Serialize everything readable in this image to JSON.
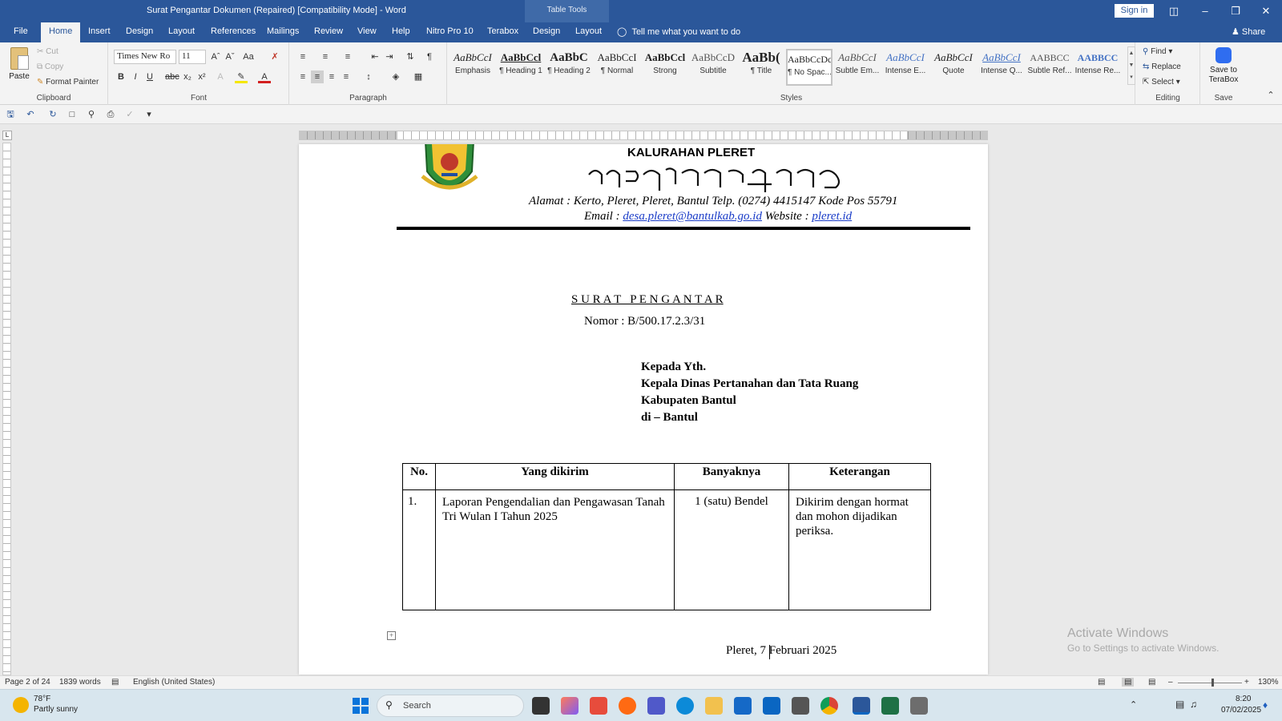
{
  "window": {
    "title": "Surat Pengantar Dokumen (Repaired) [Compatibility Mode]  -  Word",
    "contextual_tab_group": "Table Tools",
    "sign_in": "Sign in"
  },
  "tabs": {
    "file": "File",
    "home": "Home",
    "insert": "Insert",
    "design": "Design",
    "layout": "Layout",
    "references": "References",
    "mailings": "Mailings",
    "review": "Review",
    "view": "View",
    "help": "Help",
    "nitro": "Nitro Pro 10",
    "terabox": "Terabox",
    "table_design": "Design",
    "table_layout": "Layout",
    "tell_me": "Tell me what you want to do",
    "share": "Share"
  },
  "ribbon": {
    "clipboard": {
      "paste": "Paste",
      "cut": "Cut",
      "copy": "Copy",
      "format_painter": "Format Painter",
      "label": "Clipboard"
    },
    "font": {
      "name": "Times New Ro",
      "size": "11",
      "label": "Font"
    },
    "paragraph": {
      "label": "Paragraph"
    },
    "styles": {
      "label": "Styles",
      "items": [
        {
          "preview": "AaBbCcI",
          "name": "Emphasis"
        },
        {
          "preview": "AaBbCcl",
          "name": "¶ Heading 1"
        },
        {
          "preview": "AaBbC",
          "name": "¶ Heading 2"
        },
        {
          "preview": "AaBbCcI",
          "name": "¶ Normal"
        },
        {
          "preview": "AaBbCcl",
          "name": "Strong"
        },
        {
          "preview": "AaBbCcD",
          "name": "Subtitle"
        },
        {
          "preview": "AaBb(",
          "name": "¶ Title"
        },
        {
          "preview": "AaBbCcDc",
          "name": "¶ No Spac..."
        },
        {
          "preview": "AaBbCcI",
          "name": "Subtle Em..."
        },
        {
          "preview": "AaBbCcI",
          "name": "Intense E..."
        },
        {
          "preview": "AaBbCcI",
          "name": "Quote"
        },
        {
          "preview": "AaBbCcI",
          "name": "Intense Q..."
        },
        {
          "preview": "AABBCC",
          "name": "Subtle Ref..."
        },
        {
          "preview": "AABBCC",
          "name": "Intense Re..."
        }
      ]
    },
    "editing": {
      "find": "Find",
      "replace": "Replace",
      "select": "Select",
      "label": "Editing"
    },
    "save": {
      "button": "Save to TeraBox",
      "label": "Save"
    }
  },
  "document": {
    "org": "KALURAHAN PLERET",
    "address_line": "Alamat : Kerto, Pleret, Pleret, Bantul Telp. (0274) 4415147  Kode Pos 55791",
    "email_label": "Email : ",
    "email": "desa.pleret@bantulkab.go.id",
    "website_label": " Website : ",
    "website": "pleret.id",
    "heading": "S U R A T   P E N G A N T A R",
    "number": "Nomor : B/500.17.2.3/31",
    "recipient": [
      "Kepada Yth.",
      "Kepala Dinas Pertanahan dan Tata Ruang",
      "Kabupaten Bantul",
      "di – Bantul"
    ],
    "table": {
      "headers": [
        "No.",
        "Yang dikirim",
        "Banyaknya",
        "Keterangan"
      ],
      "rows": [
        [
          "1.",
          "Laporan Pengendalian dan Pengawasan Tanah Tri Wulan I Tahun 2025",
          "1 (satu) Bendel",
          "Dikirim dengan hormat dan mohon dijadikan periksa."
        ]
      ]
    },
    "date_line": "Pleret, 7 Februari 2025"
  },
  "watermark": {
    "title": "Activate Windows",
    "subtitle": "Go to Settings to activate Windows."
  },
  "status": {
    "page": "Page 2 of 24",
    "words": "1839 words",
    "language": "English (United States)",
    "zoom": "130%"
  },
  "taskbar": {
    "weather_temp": "78°F",
    "weather_desc": "Partly sunny",
    "search": "Search",
    "time": "8:20",
    "date": "07/02/2025"
  }
}
